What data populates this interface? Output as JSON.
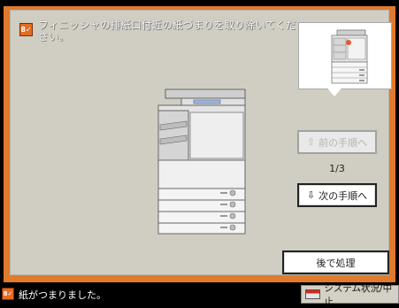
{
  "message": "フィニッシャの排紙口付近の紙づまりを取り除いてください。",
  "step": {
    "current": 1,
    "total": 3,
    "label": "1/3"
  },
  "buttons": {
    "prev": "前の手順へ",
    "next": "次の手順へ",
    "later": "後で処理"
  },
  "status": {
    "text": "紙がつまりました。",
    "system_button": "システム状況/中止"
  },
  "icons": {
    "warning": "paper-jam-warning-icon",
    "up": "arrow-up-icon",
    "down": "arrow-down-icon",
    "system": "system-status-icon"
  },
  "colors": {
    "frame": "#e07a2d",
    "panel": "#d0cdc2",
    "highlight": "#e65a2a"
  }
}
